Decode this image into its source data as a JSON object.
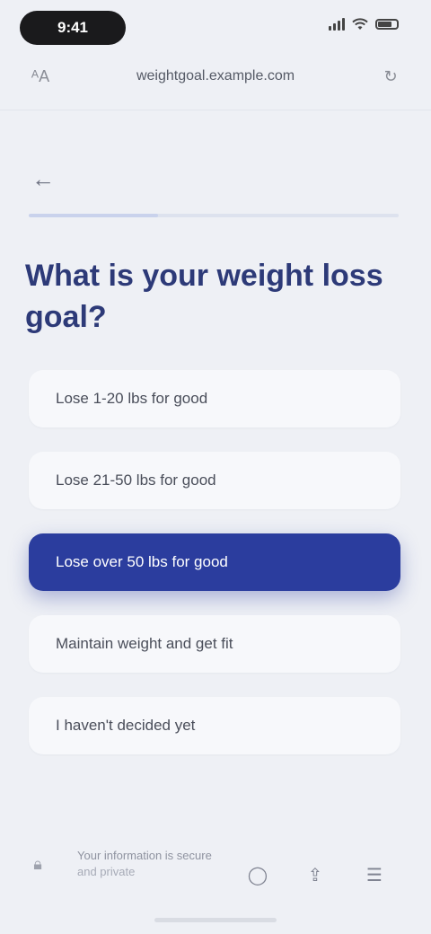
{
  "status_bar": {
    "time": "9:41"
  },
  "browser": {
    "url": "weightgoal.example.com",
    "left_icon": "aa-icon",
    "right_icon": "refresh-icon"
  },
  "page": {
    "back_icon": "arrow-left-icon",
    "progress_fraction": 0.35,
    "title": "What is your weight loss goal?",
    "options": [
      {
        "label": "Lose 1-20 lbs for good",
        "selected": false
      },
      {
        "label": "Lose 21-50 lbs for good",
        "selected": false
      },
      {
        "label": "Lose over 50 lbs for good",
        "selected": true
      },
      {
        "label": "Maintain weight and get fit",
        "selected": false
      },
      {
        "label": "I haven't decided yet",
        "selected": false
      }
    ]
  },
  "bottom_bar": {
    "line1": "Your information is secure",
    "line2": "and private",
    "icons": [
      "chat-icon",
      "share-icon",
      "menu-icon"
    ]
  },
  "colors": {
    "accent": "#2b3d9e",
    "title": "#2d3a78",
    "background": "#eef0f5"
  }
}
